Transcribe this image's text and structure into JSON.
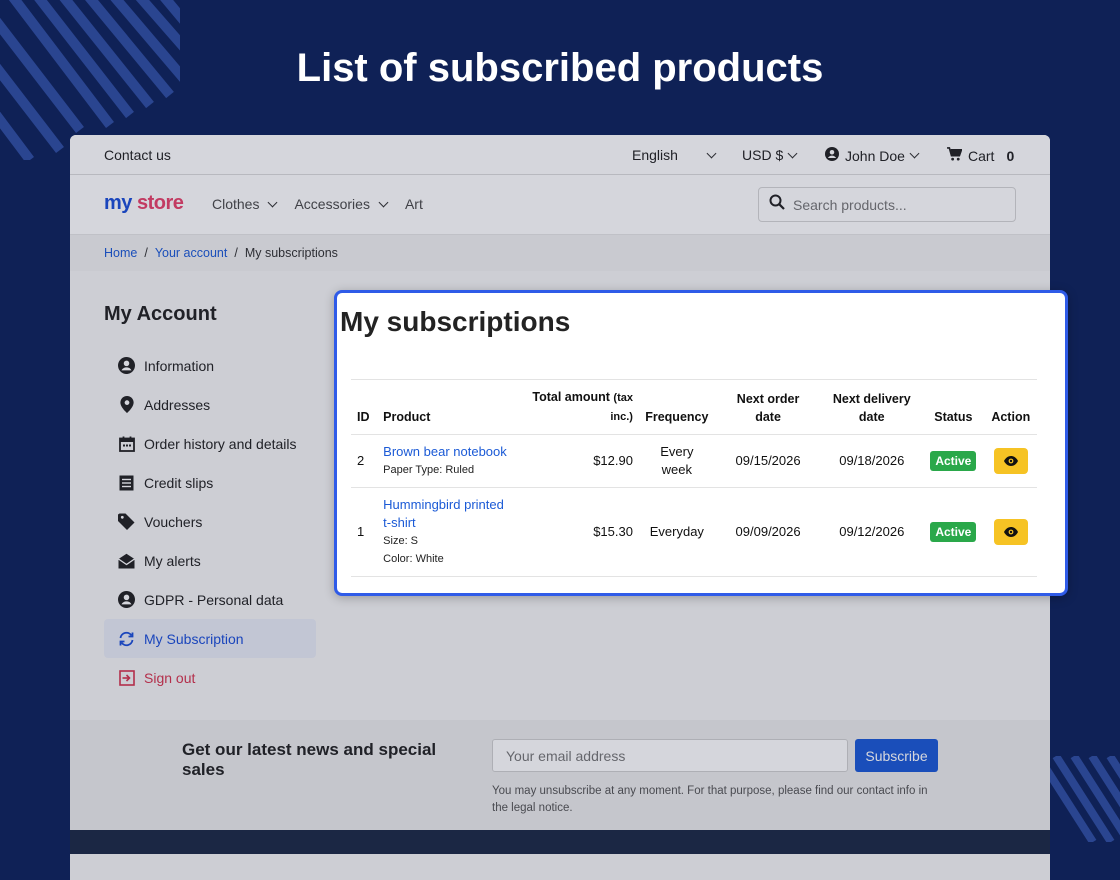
{
  "hero_title": "List of subscribed products",
  "topbar": {
    "contact": "Contact us",
    "language": "English",
    "currency": "USD $",
    "user": "John Doe",
    "cart_label": "Cart",
    "cart_count": "0"
  },
  "header": {
    "logo_my": "my",
    "logo_store": "store",
    "nav": [
      "Clothes",
      "Accessories",
      "Art"
    ],
    "search_placeholder": "Search products..."
  },
  "breadcrumb": {
    "home": "Home",
    "account": "Your account",
    "current": "My subscriptions"
  },
  "sidebar": {
    "title": "My Account",
    "items": [
      {
        "label": "Information",
        "icon": "user-circle-icon"
      },
      {
        "label": "Addresses",
        "icon": "map-pin-icon"
      },
      {
        "label": "Order history and details",
        "icon": "calendar-icon"
      },
      {
        "label": "Credit slips",
        "icon": "document-icon"
      },
      {
        "label": "Vouchers",
        "icon": "tag-icon"
      },
      {
        "label": "My alerts",
        "icon": "envelope-open-icon"
      },
      {
        "label": "GDPR - Personal data",
        "icon": "user-circle-icon"
      },
      {
        "label": "My Subscription",
        "icon": "refresh-icon"
      },
      {
        "label": "Sign out",
        "icon": "sign-out-icon"
      }
    ]
  },
  "subscriptions": {
    "title": "My subscriptions",
    "headers": {
      "id": "ID",
      "product": "Product",
      "total": "Total amount",
      "total_small_1": "(tax",
      "total_small_2": "inc.)",
      "frequency": "Frequency",
      "next_order_1": "Next order",
      "next_order_2": "date",
      "next_delivery_1": "Next delivery",
      "next_delivery_2": "date",
      "status": "Status",
      "action": "Action"
    },
    "rows": [
      {
        "id": "2",
        "product": "Brown bear notebook",
        "attr1": "Paper Type: Ruled",
        "attr2": "",
        "total": "$12.90",
        "frequency": "Every week",
        "next_order": "09/15/2026",
        "next_delivery": "09/18/2026",
        "status": "Active"
      },
      {
        "id": "1",
        "product": "Hummingbird printed t-shirt",
        "attr1": "Size: S",
        "attr2": "Color: White",
        "total": "$15.30",
        "frequency": "Everyday",
        "next_order": "09/09/2026",
        "next_delivery": "09/12/2026",
        "status": "Active"
      }
    ]
  },
  "newsletter": {
    "title": "Get our latest news and special sales",
    "placeholder": "Your email address",
    "button": "Subscribe",
    "note": "You may unsubscribe at any moment. For that purpose, please find our contact info in the legal notice."
  },
  "colors": {
    "background": "#0f2156",
    "accent": "#2f5be8",
    "link": "#1b5ad6",
    "active_badge": "#2aa84a",
    "action_button": "#f6c324",
    "sign_out": "#d6344f"
  }
}
